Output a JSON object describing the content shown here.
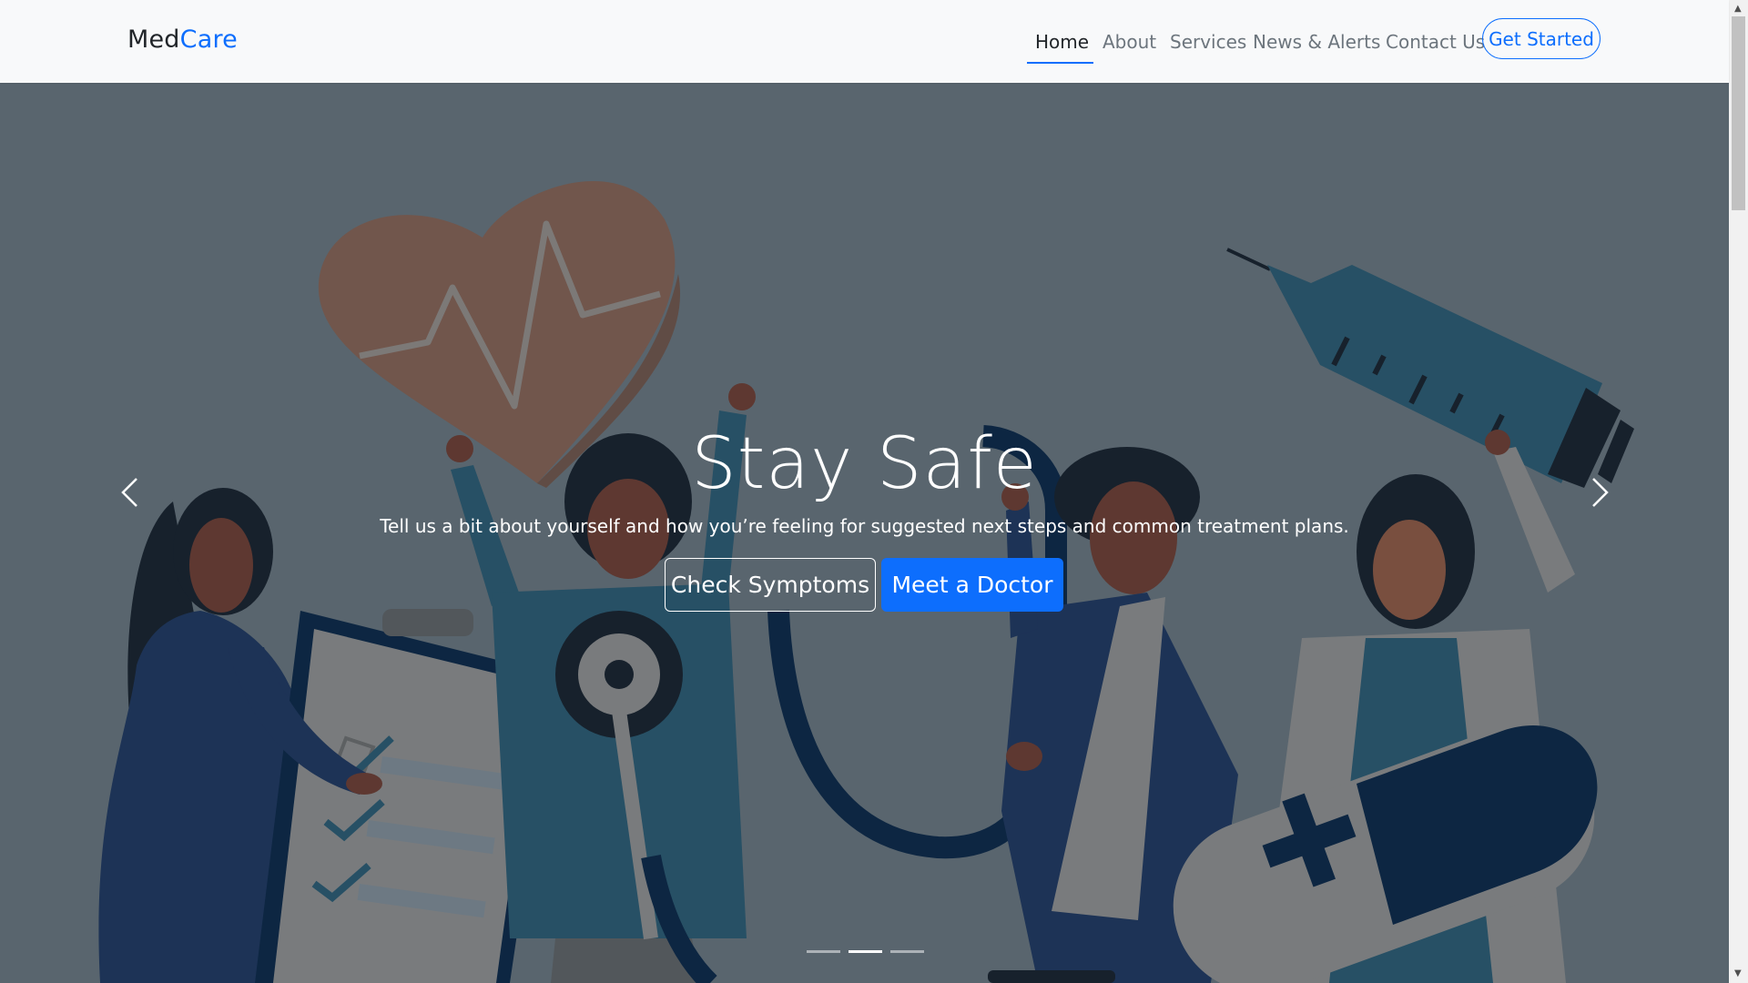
{
  "navbar": {
    "brand_part1": "Med",
    "brand_part2": "Care",
    "links": [
      "Home",
      "About",
      "Services",
      "News & Alerts",
      "Contact Us"
    ],
    "active_link": "Home",
    "cta_label": "Get Started"
  },
  "hero": {
    "title": "Stay Safe",
    "subtitle": "Tell us a bit about yourself and how you’re feeling for suggested next steps and common treatment plans.",
    "primary_outline_label": "Check Symptoms",
    "primary_label": "Meet a Doctor",
    "prev_icon": "chevron-left-icon",
    "next_icon": "chevron-right-icon",
    "slides_total": 3,
    "active_slide": 2
  },
  "colors": {
    "brand_accent": "#0d6efd",
    "navbar_bg": "#f8f9fa",
    "hero_overlay": "#66747e"
  }
}
